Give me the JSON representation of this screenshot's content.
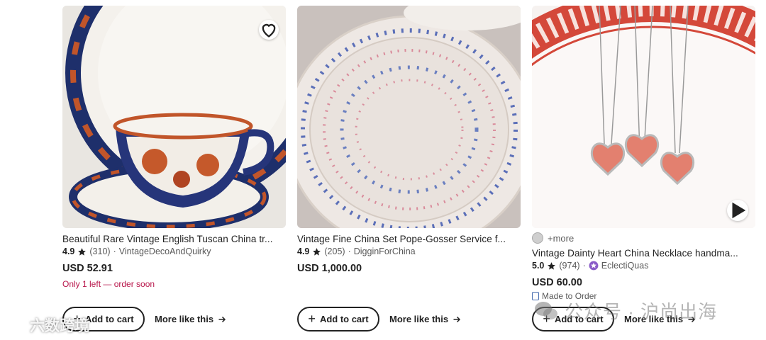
{
  "colors": {
    "sale_text": "#b8164b",
    "text": "#222222",
    "muted": "#595959"
  },
  "listings": [
    {
      "title": "Beautiful Rare Vintage English Tuscan China tr...",
      "rating": "4.9",
      "reviews": "(310)",
      "separator": "·",
      "shop": "VintageDecoAndQuirky",
      "price": "USD 52.91",
      "stock_note": "Only 1 left — order soon",
      "image_icon": "favorite-heart-icon"
    },
    {
      "title": "Vintage Fine China Set Pope-Gosser Service f...",
      "rating": "4.9",
      "reviews": "(205)",
      "separator": "·",
      "shop": "DigginForChina",
      "price": "USD 1,000.00"
    },
    {
      "more_variations": "+more",
      "title": "Vintage Dainty Heart China Necklace handma...",
      "rating": "5.0",
      "reviews": "(974)",
      "separator": "·",
      "shop": "EclectiQuas",
      "price": "USD 60.00",
      "made_to_order": "Made to Order",
      "image_icon": "play-video-icon"
    }
  ],
  "actions": {
    "add_to_cart": "Add to cart",
    "more_like_this": "More like this"
  },
  "watermarks": {
    "left": "六数跨境",
    "right": "公众号 · 沪尚出海"
  }
}
